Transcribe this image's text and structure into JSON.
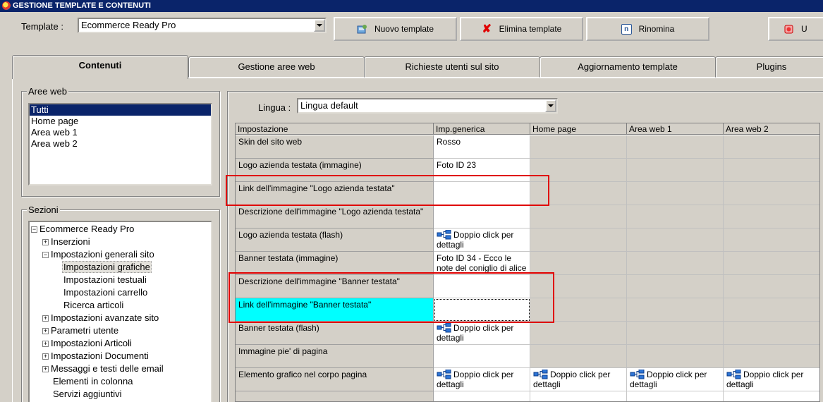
{
  "window": {
    "title": "GESTIONE TEMPLATE E CONTENUTI"
  },
  "toolbar": {
    "template_label": "Template :",
    "template_value": "Ecommerce Ready Pro",
    "new_label": "Nuovo template",
    "delete_label": "Elimina template",
    "rename_label": "Rinomina",
    "exit_label": "U"
  },
  "tabs": [
    "Contenuti",
    "Gestione aree web",
    "Richieste utenti sul sito",
    "Aggiornamento template",
    "Plugins"
  ],
  "aree": {
    "title": "Aree web",
    "items": [
      "Tutti",
      "Home page",
      "Area web 1",
      "Area web 2"
    ]
  },
  "sezioni": {
    "title": "Sezioni",
    "items": [
      "Ecommerce Ready Pro",
      "Inserzioni",
      "Impostazioni generali sito",
      "Impostazioni grafiche",
      "Impostazioni testuali",
      "Impostazioni carrello",
      "Ricerca articoli",
      "Impostazioni avanzate sito",
      "Parametri utente",
      "Impostazioni Articoli",
      "Impostazioni Documenti",
      "Messaggi e testi delle email",
      "Elementi in colonna",
      "Servizi aggiuntivi"
    ]
  },
  "lingua": {
    "label": "Lingua :",
    "value": "Lingua default"
  },
  "grid": {
    "headers": [
      "Impostazione",
      "Imp.generica",
      "Home page",
      "Area web 1",
      "Area web 2"
    ],
    "rows": [
      {
        "label": "Skin del sito web",
        "value": "Rosso"
      },
      {
        "label": "Logo azienda testata (immagine)",
        "value": "Foto ID 23"
      },
      {
        "label": "Link dell'immagine \"Logo azienda testata\"",
        "value": ""
      },
      {
        "label": "Descrizione dell'immagine \"Logo azienda testata\"",
        "value": ""
      },
      {
        "label": "Logo azienda testata (flash)",
        "value": "Doppio click per dettagli"
      },
      {
        "label": "Banner testata (immagine)",
        "value": "Foto ID 34 - Ecco le note del coniglio di alice"
      },
      {
        "label": "Descrizione dell'immagine \"Banner testata\"",
        "value": ""
      },
      {
        "label": "Link dell'immagine \"Banner testata\"",
        "value": ""
      },
      {
        "label": "Banner testata (flash)",
        "value": "Doppio click per dettagli"
      },
      {
        "label": "Immagine pie' di pagina",
        "value": ""
      },
      {
        "label": "Elemento grafico nel corpo pagina",
        "value": "Doppio click per dettagli",
        "home": "Doppio click per dettagli",
        "area1": "Doppio click per dettagli",
        "area2": "Doppio click per dettagli"
      }
    ]
  },
  "colors": {
    "highlight": "#00ffff",
    "selection": "#0a246a",
    "annotation": "#e00000"
  }
}
